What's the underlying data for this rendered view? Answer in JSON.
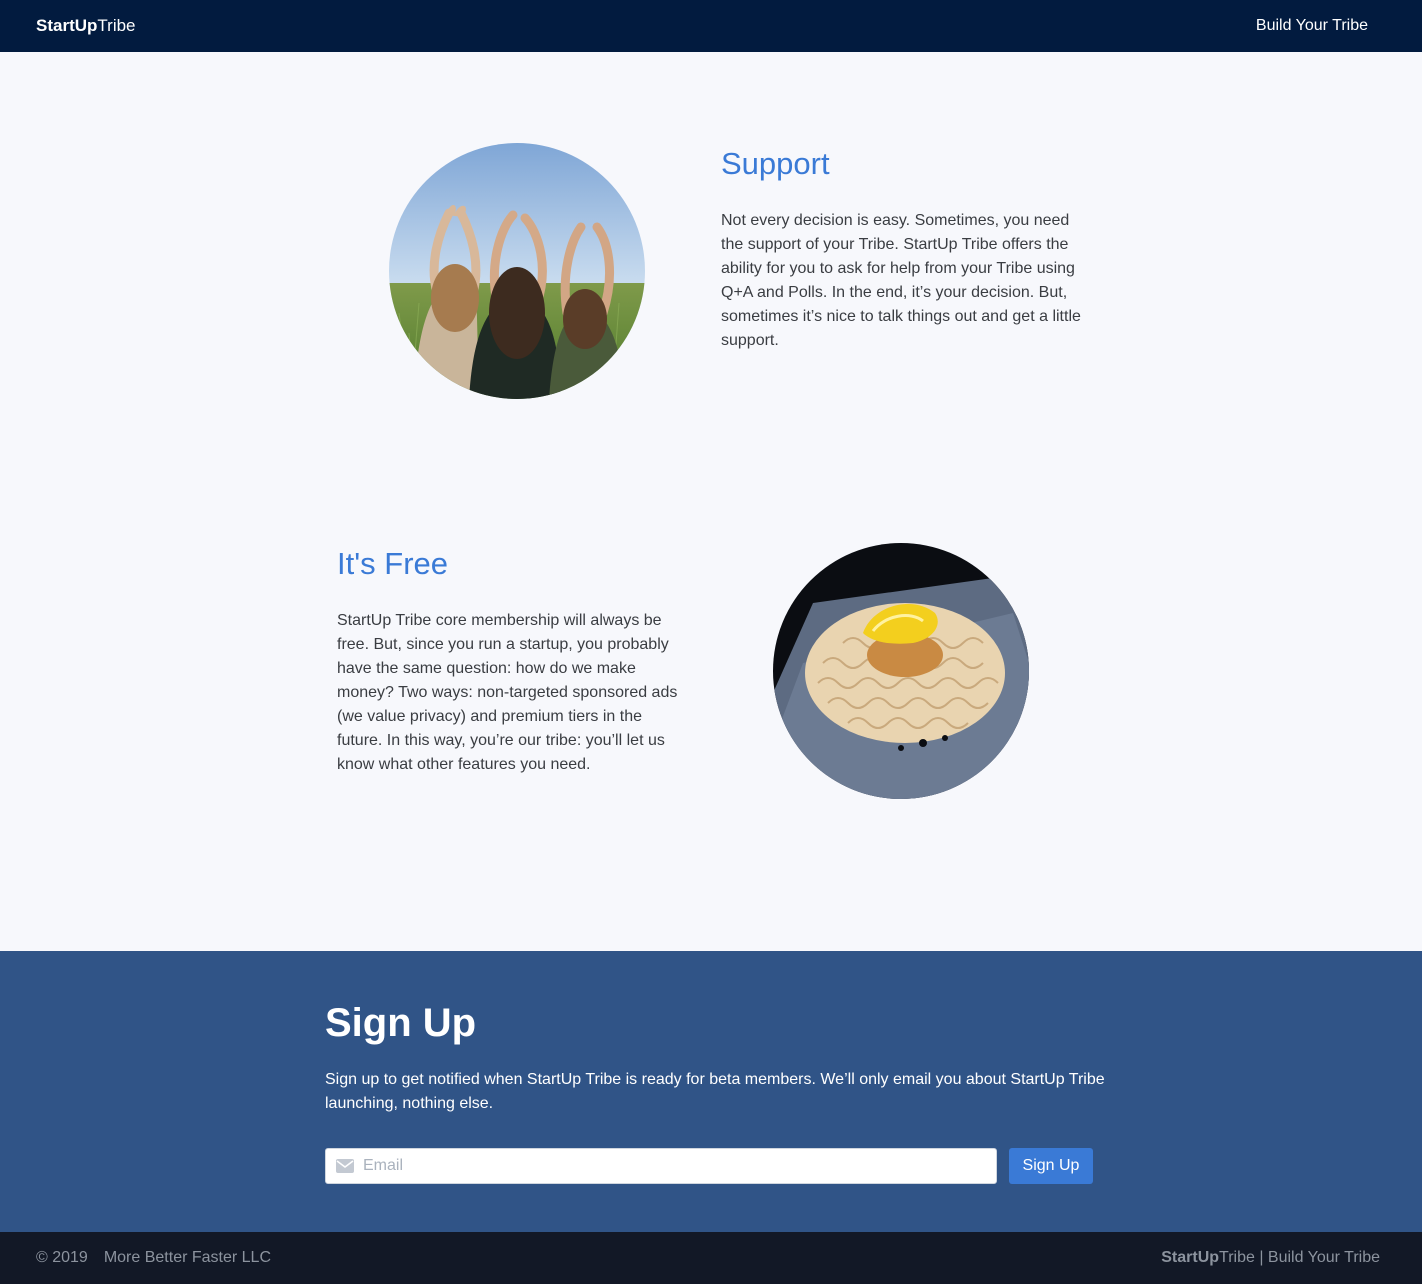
{
  "navbar": {
    "brand_bold": "StartUp",
    "brand_rest": "Tribe",
    "link": "Build Your Tribe",
    "bg_color": "#021b3f"
  },
  "support": {
    "title": "Support",
    "body": "Not every decision is easy. Sometimes, you need the support of your Tribe. StartUp Tribe offers the ability for you to ask for help from your Tribe using Q+A and Polls. In the end, it’s your decision. But, sometimes it’s nice to talk things out and get a little support."
  },
  "free": {
    "title": "It's Free",
    "body": "StartUp Tribe core membership will always be free. But, since you run a startup, you probably have the same question: how do we make money? Two ways: non-targeted sponsored ads (we value privacy) and premium tiers in the future. In this way, you’re our tribe: you’ll let us know what other features you need."
  },
  "signup": {
    "title": "Sign Up",
    "lead": "Sign up to get notified when StartUp Tribe is ready for beta members. We’ll only email you about StartUp Tribe launching, nothing else.",
    "email_placeholder": "Email",
    "email_value": "",
    "button_label": "Sign Up",
    "bg_color": "#305487",
    "accent_color": "#3a7ad6"
  },
  "footer": {
    "copyright": "© 2019",
    "company": "More Better Faster LLC",
    "brand_bold": "StartUp",
    "brand_rest": "Tribe",
    "separator": " | ",
    "tagline": "Build Your Tribe",
    "bg_color": "#121826"
  },
  "icons": {
    "email_input_icon": "envelope-icon"
  }
}
